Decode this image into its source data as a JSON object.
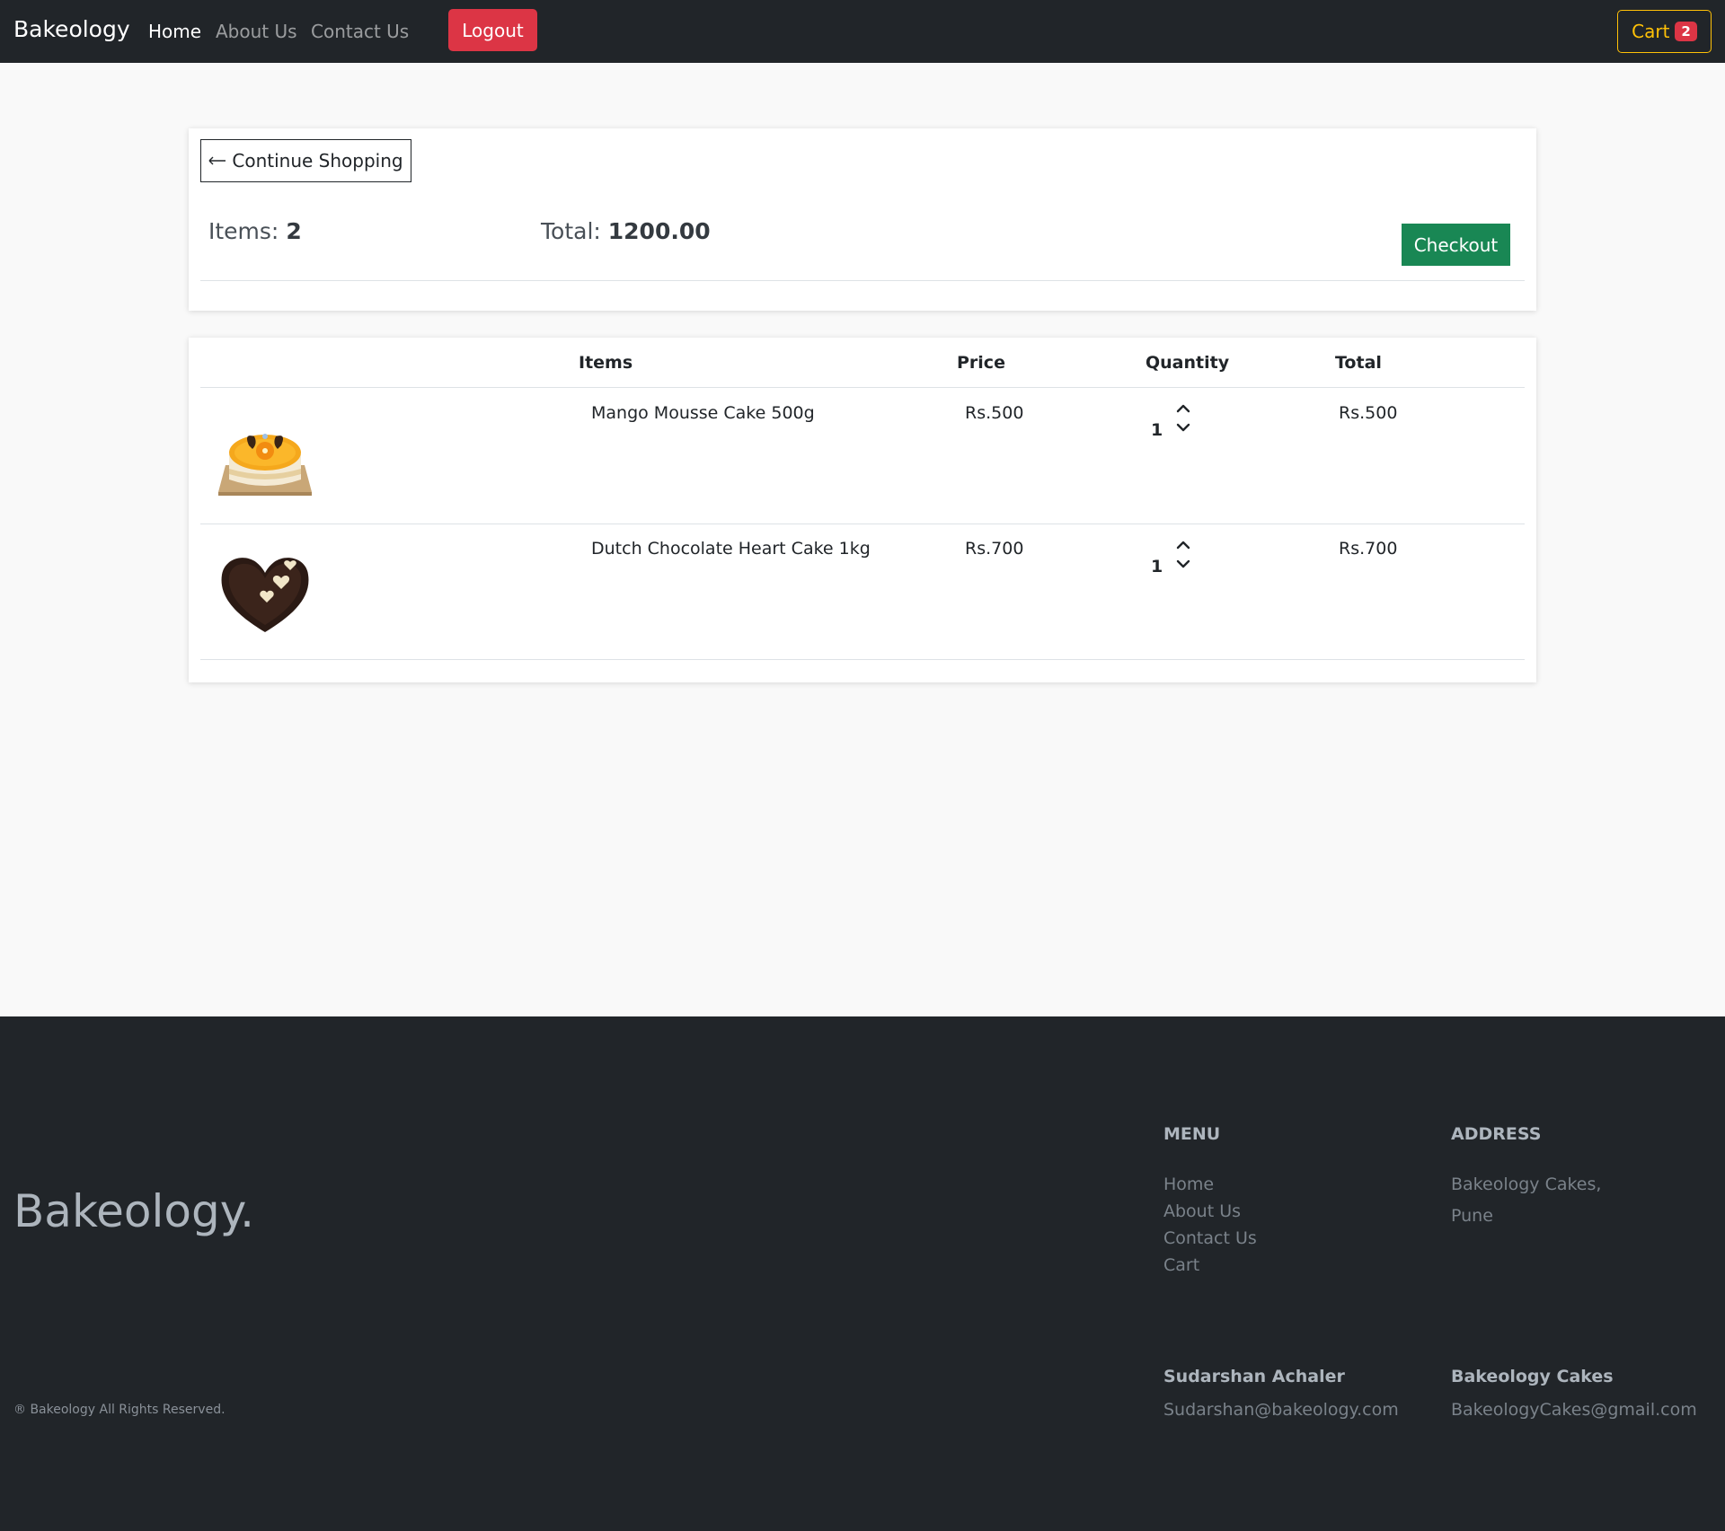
{
  "navbar": {
    "brand": "Bakeology",
    "links": [
      "Home",
      "About Us",
      "Contact Us"
    ],
    "logout_label": "Logout",
    "cart_label": "Cart",
    "cart_count": "2"
  },
  "summary": {
    "continue_label": "Continue Shopping",
    "items_label": "Items:",
    "items_count": "2",
    "total_label": "Total:",
    "total_value": "1200.00",
    "checkout_label": "Checkout"
  },
  "table": {
    "headers": [
      "Items",
      "Price",
      "Quantity",
      "Total"
    ],
    "rows": [
      {
        "name": "Mango Mousse Cake 500g",
        "price": "Rs.500",
        "quantity": "1",
        "total": "Rs.500"
      },
      {
        "name": "Dutch Chocolate Heart Cake 1kg",
        "price": "Rs.700",
        "quantity": "1",
        "total": "Rs.700"
      }
    ]
  },
  "footer": {
    "brand": "Bakeology.",
    "copyright": "® Bakeology All Rights Reserved.",
    "menu_title": "MENU",
    "menu_links": [
      "Home",
      "About Us",
      "Contact Us",
      "Cart"
    ],
    "address_title": "ADDRESS",
    "address_lines": [
      "Bakeology Cakes,",
      "Pune"
    ],
    "contacts": [
      {
        "name": "Sudarshan Achaler",
        "email": "Sudarshan@bakeology.com"
      },
      {
        "name": "Bakeology Cakes",
        "email": "BakeologyCakes@gmail.com"
      }
    ]
  },
  "colors": {
    "navbar_bg": "#212529",
    "danger": "#dc3545",
    "warning": "#ffc107",
    "success": "#198754"
  }
}
